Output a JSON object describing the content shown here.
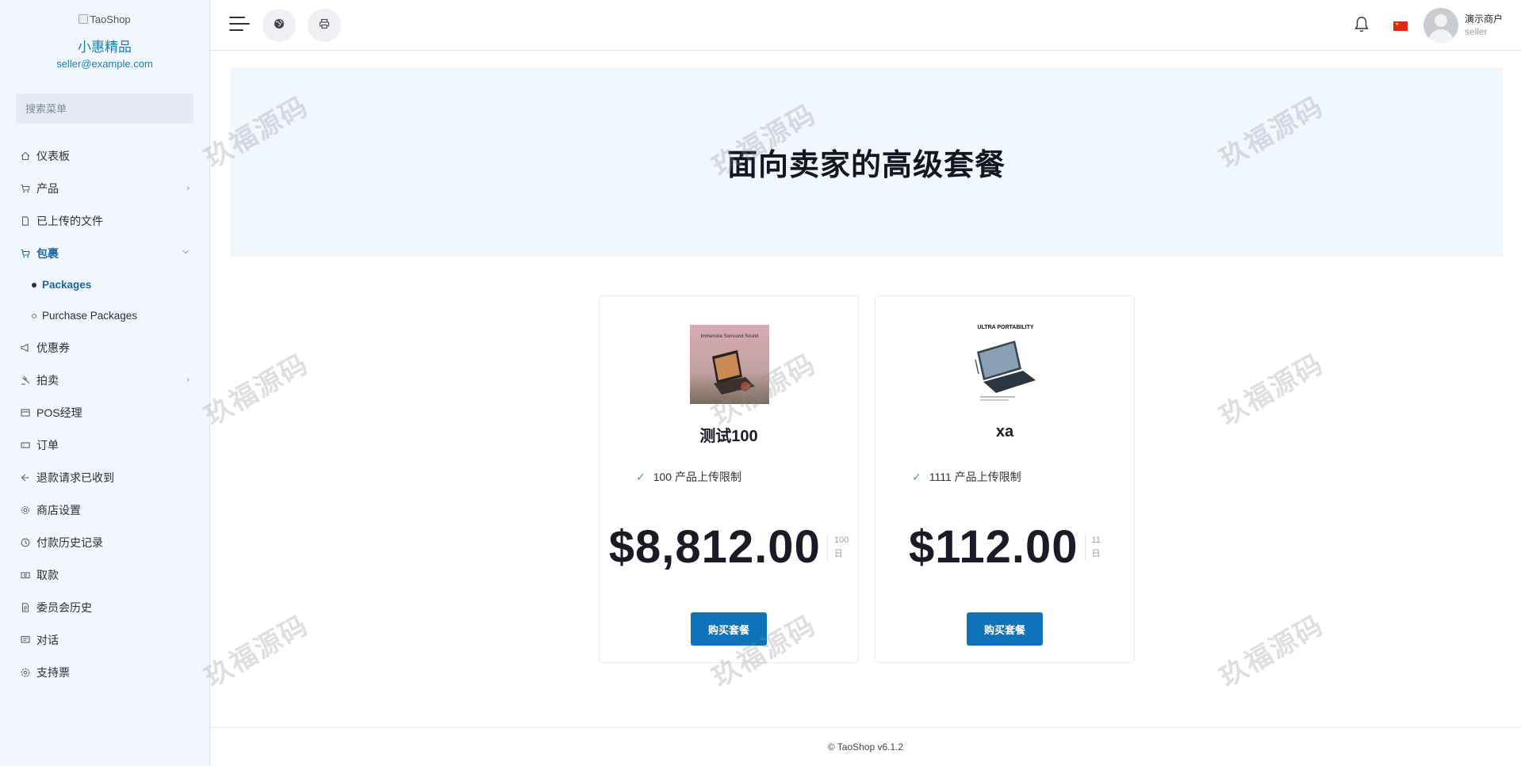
{
  "brand": {
    "logo_alt": "TaoShop",
    "store_name": "小惠精品",
    "email": "seller@example.com"
  },
  "search": {
    "placeholder": "搜索菜单"
  },
  "menu": [
    {
      "label": "仪表板",
      "icon": "home-icon",
      "chevron": ""
    },
    {
      "label": "产品",
      "icon": "cart-icon",
      "chevron": "›"
    },
    {
      "label": "已上传的文件",
      "icon": "file-icon",
      "chevron": ""
    },
    {
      "label": "包裹",
      "icon": "cart-icon",
      "chevron": "⌄",
      "active": true
    }
  ],
  "submenu": [
    {
      "label": "Packages",
      "active": true
    },
    {
      "label": "Purchase Packages",
      "active": false
    }
  ],
  "menu2": [
    {
      "label": "优惠券",
      "icon": "megaphone-icon",
      "chevron": ""
    },
    {
      "label": "拍卖",
      "icon": "gavel-icon",
      "chevron": "›"
    },
    {
      "label": "POS经理",
      "icon": "pos-icon",
      "chevron": ""
    },
    {
      "label": "订单",
      "icon": "ticket-icon",
      "chevron": ""
    },
    {
      "label": "退款请求已收到",
      "icon": "refund-icon",
      "chevron": ""
    },
    {
      "label": "商店设置",
      "icon": "gear-icon",
      "chevron": ""
    },
    {
      "label": "付款历史记录",
      "icon": "history-icon",
      "chevron": ""
    },
    {
      "label": "取款",
      "icon": "money-icon",
      "chevron": ""
    },
    {
      "label": "委员会历史",
      "icon": "document-icon",
      "chevron": ""
    },
    {
      "label": "对话",
      "icon": "chat-icon",
      "chevron": ""
    },
    {
      "label": "支持票",
      "icon": "support-icon",
      "chevron": ""
    }
  ],
  "header": {
    "user_name": "演示商户",
    "user_role": "seller"
  },
  "hero": {
    "title": "面向卖家的高级套餐"
  },
  "packages": [
    {
      "name": "测试100",
      "feature": "100 产品上传限制",
      "price": "$8,812.00",
      "duration_num": "100",
      "duration_unit": "日",
      "button": "购买套餐",
      "image_caption": "Immersive Surround Sound"
    },
    {
      "name": "xa",
      "feature": "1111 产品上传限制",
      "price": "$112.00",
      "duration_num": "11",
      "duration_unit": "日",
      "button": "购买套餐",
      "image_caption": "ULTRA PORTABILITY"
    }
  ],
  "footer": {
    "text": "© TaoShop v6.1.2"
  },
  "watermark": "玖福源码",
  "colors": {
    "accent": "#0e73b8",
    "sidebar_bg": "#f1f7fd",
    "hero_bg": "#f0f7fd",
    "active_text": "#1867a3"
  }
}
